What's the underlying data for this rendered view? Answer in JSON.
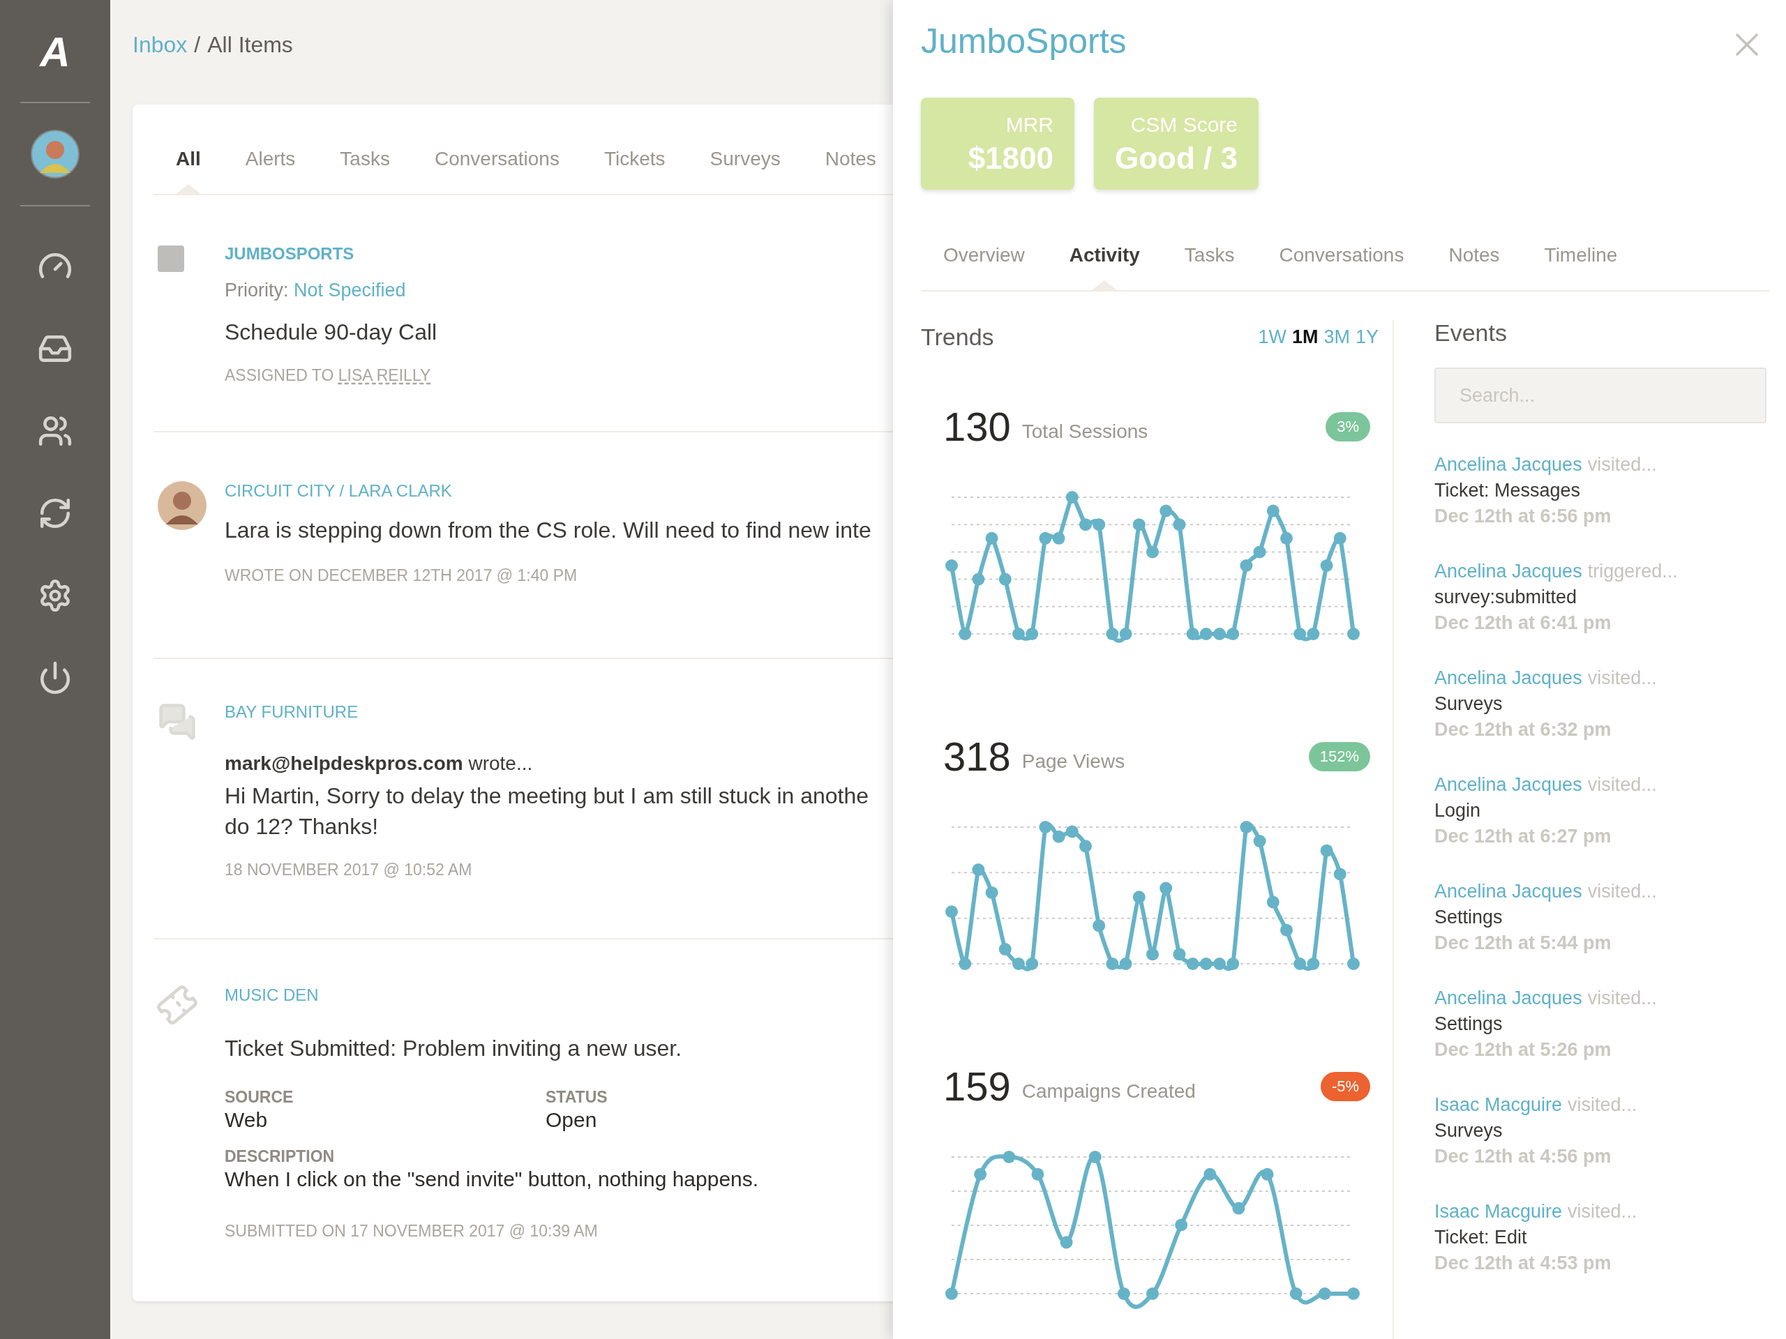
{
  "sidebar": {
    "logo": "A",
    "items": [
      {
        "selected": false
      },
      {
        "selected": false
      },
      {
        "selected": false
      },
      {
        "selected": false
      },
      {
        "selected": false
      },
      {
        "selected": false
      }
    ]
  },
  "breadcrumb": {
    "link": "Inbox",
    "separator": "/",
    "current": "All Items"
  },
  "feed": {
    "tabs": [
      {
        "label": "All",
        "selected": true
      },
      {
        "label": "Alerts",
        "selected": false
      },
      {
        "label": "Tasks",
        "selected": false
      },
      {
        "label": "Conversations",
        "selected": false
      },
      {
        "label": "Tickets",
        "selected": false
      },
      {
        "label": "Surveys",
        "selected": false
      },
      {
        "label": "Notes",
        "selected": false
      }
    ],
    "items": [
      {
        "kind": "task",
        "checked": false,
        "company": "JUMBOSPORTS",
        "priority_label": "Priority:",
        "priority": "Not Specified",
        "title": "Schedule 90-day Call",
        "assigned_label": "ASSIGNED TO",
        "assignee": "LISA REILLY"
      },
      {
        "kind": "note",
        "company": "CIRCUIT CITY / LARA CLARK",
        "lines": [
          "Lara is stepping down from the CS role. Will need to find new inte"
        ],
        "meta": "WROTE ON DECEMBER 12TH 2017 @ 1:40 PM"
      },
      {
        "kind": "conversation",
        "company": "BAY FURNITURE",
        "from": "**mark@helpdeskpros.com** wrote...",
        "lines": [
          "Hi Martin, Sorry to delay the meeting but I am still stuck in anothe",
          "do 12? Thanks!"
        ],
        "meta": "18 NOVEMBER 2017 @ 10:52 AM"
      },
      {
        "kind": "ticket",
        "company": "MUSIC DEN",
        "title": "Ticket Submitted: Problem inviting a new user.",
        "fields": [
          {
            "label": "SOURCE",
            "value": "Web"
          },
          {
            "label": "STATUS",
            "value": "Open"
          }
        ],
        "description_label": "DESCRIPTION",
        "description": "When I click on the \"send invite\" button, nothing happens.",
        "meta": "SUBMITTED ON 17 NOVEMBER 2017 @ 10:39 AM"
      }
    ]
  },
  "panel": {
    "title": "JumboSports",
    "kpis": [
      {
        "label": "MRR",
        "value": "$1800"
      },
      {
        "label": "CSM Score",
        "value": "Good / 3"
      }
    ],
    "tabs": [
      {
        "label": "Overview",
        "selected": false
      },
      {
        "label": "Activity",
        "selected": true
      },
      {
        "label": "Tasks",
        "selected": false
      },
      {
        "label": "Conversations",
        "selected": false
      },
      {
        "label": "Notes",
        "selected": false
      },
      {
        "label": "Timeline",
        "selected": false
      }
    ],
    "trends": {
      "title": "Trends",
      "ranges": [
        {
          "label": "1W",
          "selected": false
        },
        {
          "label": "1M",
          "selected": true
        },
        {
          "label": "3M",
          "selected": false
        },
        {
          "label": "1Y",
          "selected": false
        }
      ],
      "metrics": [
        {
          "value": "130",
          "label": "Total Sessions",
          "change": "3%",
          "color": "#7cc59a"
        },
        {
          "value": "318",
          "label": "Page Views",
          "change": "152%",
          "color": "#7cc59a"
        },
        {
          "value": "159",
          "label": "Campaigns Created",
          "change": "-5%",
          "color": "#ec6230"
        }
      ]
    },
    "events": {
      "title": "Events",
      "search": {
        "placeholder": "Search..."
      },
      "items": [
        {
          "actor": "Ancelina Jacques",
          "action": "visited...",
          "target": "Ticket: Messages",
          "time": "Dec 12th at 6:56 pm"
        },
        {
          "actor": "Ancelina Jacques",
          "action": "triggered...",
          "target": "survey:submitted",
          "time": "Dec 12th at 6:41 pm"
        },
        {
          "actor": "Ancelina Jacques",
          "action": "visited...",
          "target": "Surveys",
          "time": "Dec 12th at 6:32 pm"
        },
        {
          "actor": "Ancelina Jacques",
          "action": "visited...",
          "target": "Login",
          "time": "Dec 12th at 6:27 pm"
        },
        {
          "actor": "Ancelina Jacques",
          "action": "visited...",
          "target": "Settings",
          "time": "Dec 12th at 5:44 pm"
        },
        {
          "actor": "Ancelina Jacques",
          "action": "visited...",
          "target": "Settings",
          "time": "Dec 12th at 5:26 pm"
        },
        {
          "actor": "Isaac Macguire",
          "action": "visited...",
          "target": "Surveys",
          "time": "Dec 12th at 4:56 pm"
        },
        {
          "actor": "Isaac Macguire",
          "action": "visited...",
          "target": "Ticket: Edit",
          "time": "Dec 12th at 4:53 pm"
        }
      ]
    }
  }
}
